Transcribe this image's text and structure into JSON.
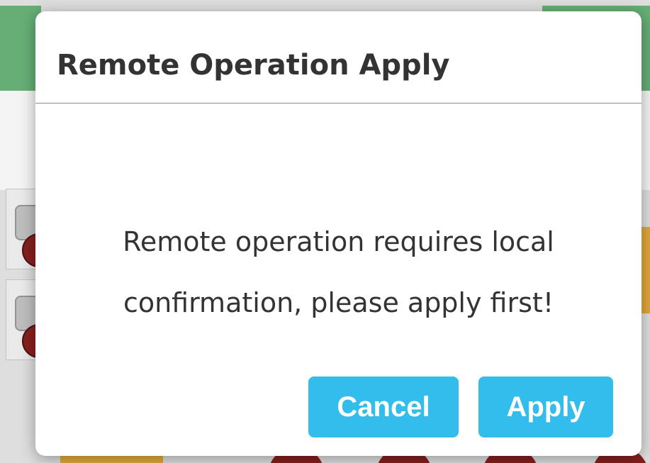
{
  "dialog": {
    "title": "Remote Operation Apply",
    "message": "Remote operation requires local confirmation, please apply first!",
    "buttons": {
      "cancel_label": "Cancel",
      "apply_label": "Apply"
    }
  },
  "colors": {
    "button_bg": "#33bdec",
    "button_text": "#ffffff",
    "title_text": "#333333",
    "background_green": "#5aa86b",
    "background_orange": "#e0a12a",
    "background_red": "#7d0c0c"
  }
}
